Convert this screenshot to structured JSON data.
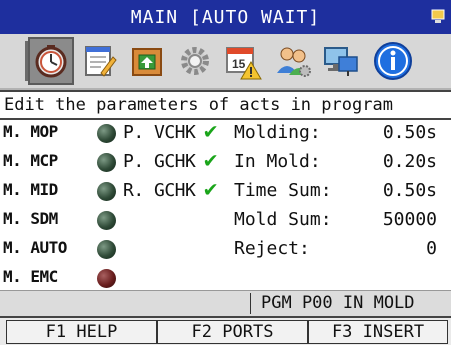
{
  "title": "MAIN [AUTO WAIT]",
  "toolbar": {
    "icons": [
      {
        "name": "timer-icon",
        "selected": true
      },
      {
        "name": "notepad-edit-icon",
        "selected": false
      },
      {
        "name": "mold-box-icon",
        "selected": false
      },
      {
        "name": "settings-gear-icon",
        "selected": false
      },
      {
        "name": "calendar-alert-icon",
        "selected": false,
        "day": "15"
      },
      {
        "name": "users-icon",
        "selected": false
      },
      {
        "name": "network-computer-icon",
        "selected": false
      },
      {
        "name": "info-icon",
        "selected": false
      }
    ]
  },
  "description": "Edit the parameters of acts in program",
  "machine_status": [
    {
      "label": "M. MOP",
      "led": "green"
    },
    {
      "label": "M. MCP",
      "led": "green"
    },
    {
      "label": "M. MID",
      "led": "green"
    },
    {
      "label": "M. SDM",
      "led": "green"
    },
    {
      "label": "M. AUTO",
      "led": "green"
    },
    {
      "label": "M. EMC",
      "led": "red"
    }
  ],
  "checks": [
    {
      "label": "P. VCHK",
      "checked": true
    },
    {
      "label": "P. GCHK",
      "checked": true
    },
    {
      "label": "R. GCHK",
      "checked": true
    }
  ],
  "params": [
    {
      "label": "Molding:",
      "value": "0.50s"
    },
    {
      "label": "In Mold:",
      "value": "0.20s"
    },
    {
      "label": "Time Sum:",
      "value": "0.50s"
    },
    {
      "label": "Mold Sum:",
      "value": "50000"
    },
    {
      "label": "Reject:",
      "value": "0"
    }
  ],
  "status": "PGM  P00 IN MOLD",
  "function_keys": [
    {
      "label": "F1 HELP"
    },
    {
      "label": "F2 PORTS"
    },
    {
      "label": "F3 INSERT"
    }
  ],
  "colors": {
    "title_bg": "#1e2f9e",
    "led_green": "#2f4a37",
    "led_red": "#6a1e1e",
    "check": "#1aa51a"
  }
}
